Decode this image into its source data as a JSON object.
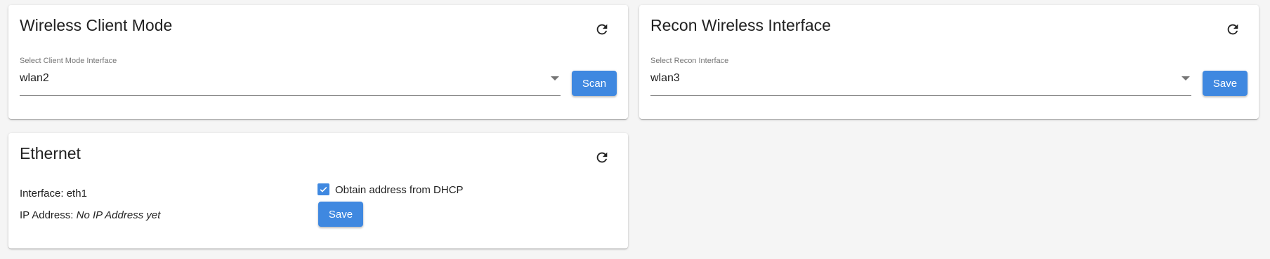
{
  "colors": {
    "accent": "#3f88e0",
    "background": "#f5f5f5",
    "card": "#ffffff"
  },
  "wireless_client": {
    "title": "Wireless Client Mode",
    "refresh_icon": "refresh-icon",
    "select_label": "Select Client Mode Interface",
    "select_value": "wlan2",
    "button_label": "Scan"
  },
  "recon_wireless": {
    "title": "Recon Wireless Interface",
    "refresh_icon": "refresh-icon",
    "select_label": "Select Recon Interface",
    "select_value": "wlan3",
    "button_label": "Save"
  },
  "ethernet": {
    "title": "Ethernet",
    "refresh_icon": "refresh-icon",
    "interface_label": "Interface:",
    "interface_value": "eth1",
    "ip_label": "IP Address:",
    "ip_value": "No IP Address yet",
    "dhcp_label": "Obtain address from DHCP",
    "dhcp_checked": true,
    "button_label": "Save"
  }
}
